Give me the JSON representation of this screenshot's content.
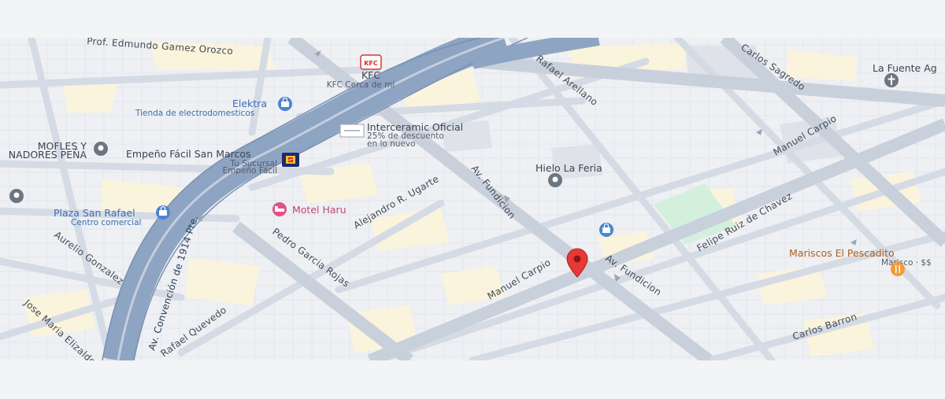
{
  "streets": {
    "prof_edmundo": "Prof. Edmundo Gamez Orozco",
    "rafael_arellano": "Rafael Arellano",
    "carlos_sagredo": "Carlos Sagredo",
    "manuel_carpio_ne": "Manuel Carpio",
    "manuel_carpio_center": "Manuel Carpio",
    "av_fundicion_upper": "Av. Fundicion",
    "av_fundicion_lower": "Av. Fundicion",
    "felipe_ruiz": "Felipe Ruiz de Chavez",
    "alejandro_ugarte": "Alejandro R. Ugarte",
    "pedro_garcia": "Pedro Garcia Rojas",
    "aurelio_gonzalez": "Aurelio Gonzalez",
    "jose_maria": "Jose Maria Elizalde",
    "rafael_quevedo": "Rafael Quevedo",
    "carlos_barron": "Carlos Barron",
    "av_convencion": "Av. Convención de 1914 Pte."
  },
  "pois": {
    "kfc": {
      "logo": "KFC",
      "name": "KFC",
      "sub": "KFC Cerca de mi"
    },
    "elektra": {
      "name": "Elektra",
      "sub": "Tienda de electrodomesticos"
    },
    "interceramic": {
      "name": "Interceramic Oficial",
      "sub1": "25% de descuento",
      "sub2": "en lo nuevo"
    },
    "empeno": {
      "name": "Empeño Fácil San Marcos",
      "sub1": "Tu Sucursal",
      "sub2": "Empeño Fácil"
    },
    "mofles": {
      "name1": "MOFLES Y",
      "name2": "NADORES PEÑA"
    },
    "plaza": {
      "name": "Plaza San Rafael",
      "sub": "Centro comercial"
    },
    "motel": {
      "name": "Motel Haru"
    },
    "hielo": {
      "name": "Hielo La Feria"
    },
    "la_fuente": {
      "name": "La Fuente Ag"
    },
    "mariscos": {
      "name": "Mariscos El Pescadito",
      "sub": "Marisco · $$"
    }
  },
  "colors": {
    "background": "#e9ebef",
    "block": "#f1f2f5",
    "commercial": "#fbf4dc",
    "road": "#cfd6e1",
    "highway": "#8ea4c3",
    "park": "#d3f0dc",
    "pin": "#e53935",
    "blue_poi": "#4a86d2",
    "pink_poi": "#e2528a",
    "orange_poi": "#f29c38",
    "gray_poi": "#6b7682"
  },
  "icons": {
    "kfc": "kfc-logo-icon",
    "elektra": "shopping-bag-icon",
    "empeno": "store-logo-icon",
    "mofles": "location-pin-icon",
    "plaza": "shopping-bag-icon",
    "motel": "bed-icon",
    "hielo": "location-pin-icon",
    "church": "cross-icon",
    "mariscos": "restaurant-icon",
    "blue_store": "shopping-bag-icon",
    "selected": "red-location-pin-icon"
  }
}
